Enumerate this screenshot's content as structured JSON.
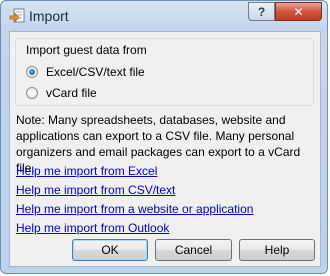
{
  "window": {
    "title": "Import",
    "help_glyph": "?",
    "close_glyph": "✕",
    "app_icon": "import-arrow-icon"
  },
  "group": {
    "title": "Import guest data from",
    "options": [
      {
        "label": "Excel/CSV/text file",
        "checked": true
      },
      {
        "label": "vCard file",
        "checked": false
      }
    ]
  },
  "note": "Note: Many spreadsheets, databases, website and applications can export to a CSV file. Many personal organizers and email packages can export to a vCard file.",
  "links": [
    "Help me import from Excel",
    "Help me import from CSV/text",
    "Help me import from a website or application",
    "Help me import from Outlook"
  ],
  "buttons": {
    "ok": "OK",
    "cancel": "Cancel",
    "help": "Help"
  },
  "colors": {
    "link": "#0000d8",
    "close_button": "#c13b22",
    "radio_selected": "#1e5ea6"
  }
}
